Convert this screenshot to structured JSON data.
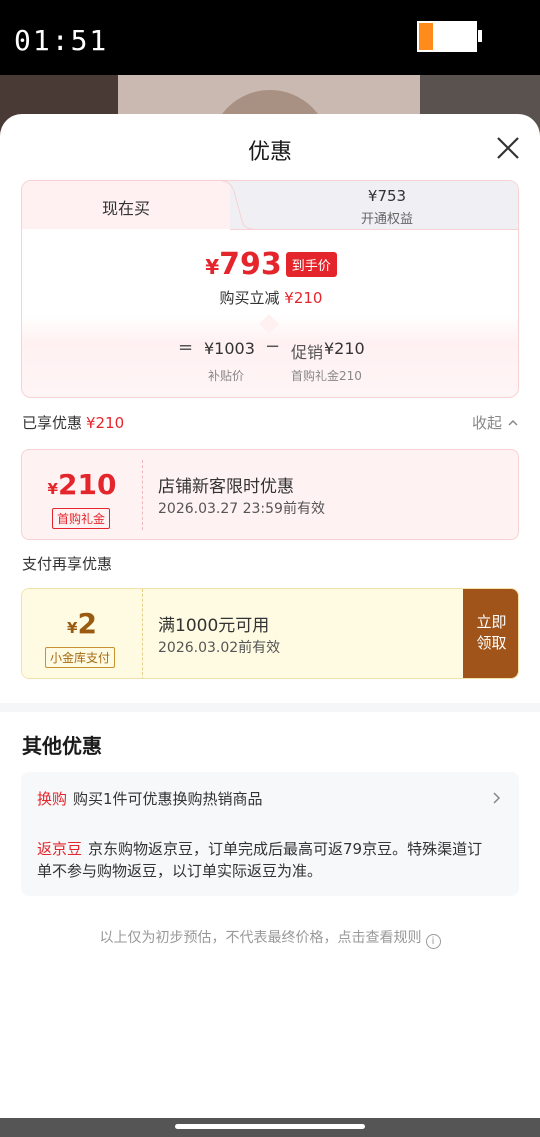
{
  "status_bar": {
    "time": "01:51",
    "battery_level": 0.25,
    "battery_color": "#ff8c1a"
  },
  "sheet": {
    "title": "优惠"
  },
  "price_tabs": {
    "active_label": "现在买",
    "inactive_price": "¥753",
    "inactive_sub": "开通权益"
  },
  "final_price": {
    "yen": "¥",
    "amount": "793",
    "badge": "到手价",
    "discount_label": "购买立减",
    "discount_value": "¥210"
  },
  "formula": {
    "equals": "=",
    "subsidy_price": "¥1003",
    "minus": "−",
    "promo_label": "促销",
    "promo_value": "¥210",
    "subsidy_label": "补贴价",
    "promo_sub": "首购礼金210"
  },
  "enjoyed": {
    "label": "已享优惠",
    "value": "¥210",
    "collapse_label": "收起"
  },
  "coupon_first": {
    "yen": "¥",
    "amount": "210",
    "tag": "首购礼金",
    "title": "店铺新客限时优惠",
    "validity": "2026.03.27 23:59前有效"
  },
  "pay_section": {
    "label": "支付再享优惠"
  },
  "coupon_pay": {
    "yen": "¥",
    "amount": "2",
    "tag": "小金库支付",
    "title": "满1000元可用",
    "validity": "2026.03.02前有效",
    "claim_line1": "立即",
    "claim_line2": "领取"
  },
  "other": {
    "title": "其他优惠",
    "exchange_tag": "换购",
    "exchange_text": "购买1件可优惠换购热销商品",
    "bean_tag": "返京豆",
    "bean_text": "京东购物返京豆，订单完成后最高可返79京豆。特殊渠道订单不参与购物返豆，以订单实际返豆为准。"
  },
  "footnote": {
    "text": "以上仅为初步预估，不代表最终价格，点击查看规则",
    "info_icon": "i"
  }
}
